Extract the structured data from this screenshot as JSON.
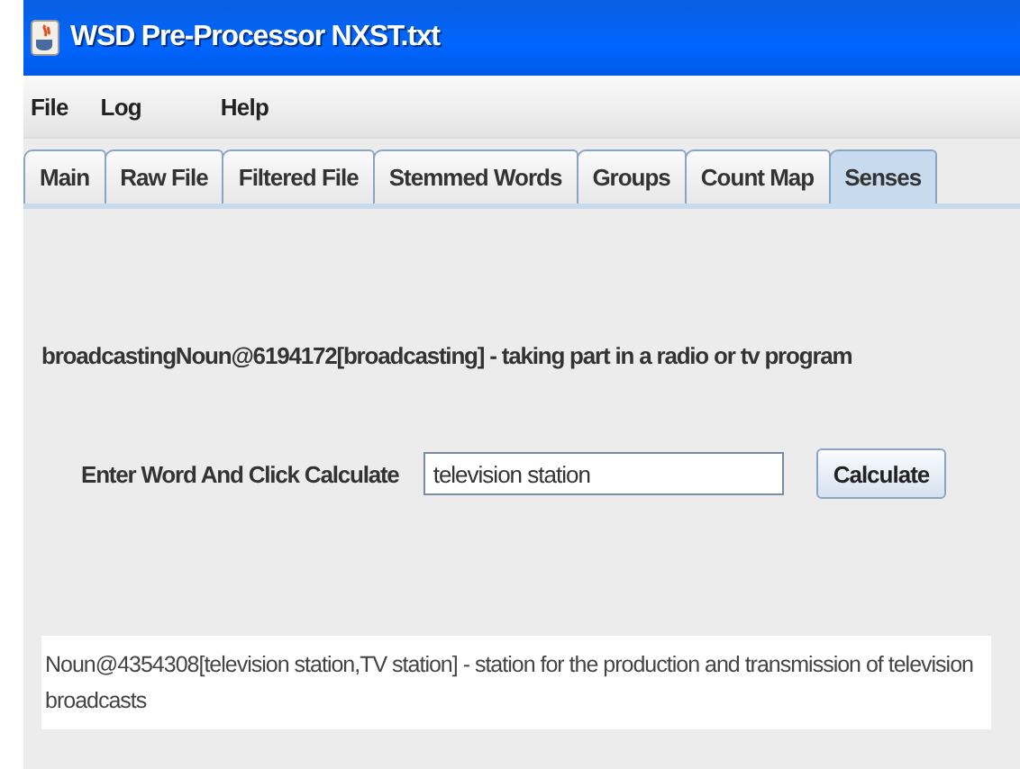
{
  "window": {
    "title": "WSD Pre-Processor NXST.txt"
  },
  "menu": [
    "File",
    "Log",
    "Help"
  ],
  "tabs": [
    {
      "label": "Main",
      "selected": false
    },
    {
      "label": "Raw File",
      "selected": false
    },
    {
      "label": "Filtered File",
      "selected": false
    },
    {
      "label": "Stemmed Words",
      "selected": false
    },
    {
      "label": "Groups",
      "selected": false
    },
    {
      "label": "Count Map",
      "selected": false
    },
    {
      "label": "Senses",
      "selected": true
    }
  ],
  "sense": "broadcastingNoun@6194172[broadcasting] - taking part in a radio or tv program",
  "form": {
    "label": "Enter Word And Click Calculate",
    "value": "television station",
    "button": "Calculate"
  },
  "result": "Noun@4354308[television station,TV station] - station for the production and transmission of television broadcasts"
}
